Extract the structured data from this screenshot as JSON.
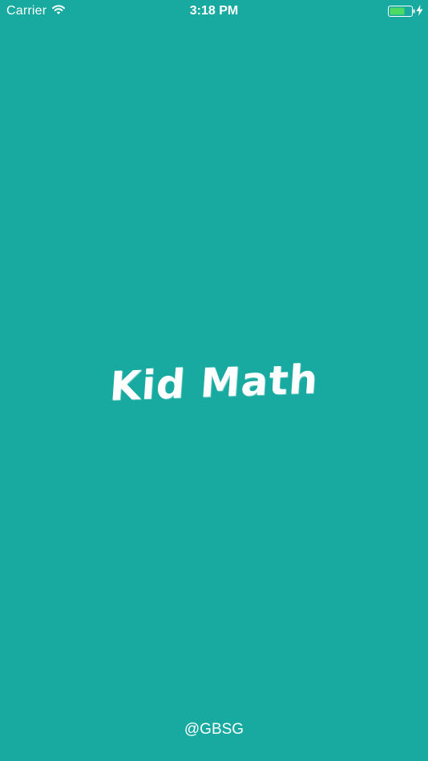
{
  "status_bar": {
    "carrier": "Carrier",
    "time": "3:18 PM",
    "icons": [
      "wifi-icon",
      "battery-icon",
      "charging-icon"
    ]
  },
  "splash": {
    "title": "Kid Math",
    "footer": "@GBSG"
  },
  "colors": {
    "background": "#18aaa0",
    "text": "#ffffff",
    "battery_fill": "#4cd964"
  }
}
